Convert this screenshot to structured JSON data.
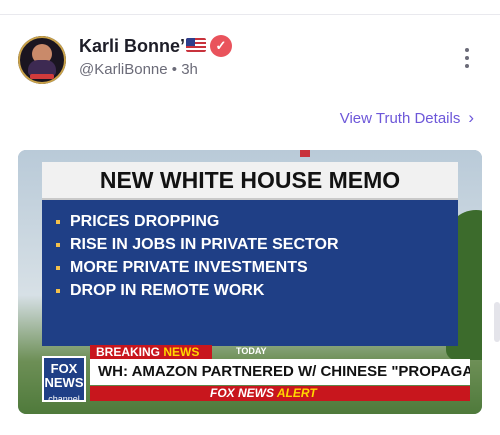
{
  "post": {
    "author_name": "Karli Bonne’",
    "author_handle": "@KarliBonne",
    "time_ago": "3h",
    "separator": "•",
    "flag_emoji": "🇺🇸",
    "details_link": "View Truth Details",
    "accent_color": "#6d57d9",
    "verified_color": "#e9535c"
  },
  "media": {
    "title": "NEW WHITE HOUSE MEMO",
    "bullets": [
      "PRICES DROPPING",
      "RISE IN JOBS IN PRIVATE SECTOR",
      "MORE PRIVATE INVESTMENTS",
      "DROP IN REMOTE WORK"
    ],
    "breaking_word1": "BREAKING ",
    "breaking_word2": "NEWS",
    "today": "TODAY",
    "logo_line1": "FOX",
    "logo_line2": "NEWS",
    "logo_line3": "channel",
    "headline": "WH: AMAZON PARTNERED W/ CHINESE \"PROPAGANDA ARM\"",
    "alert_prefix": "FOX NEWS ",
    "alert_word": "ALERT"
  }
}
